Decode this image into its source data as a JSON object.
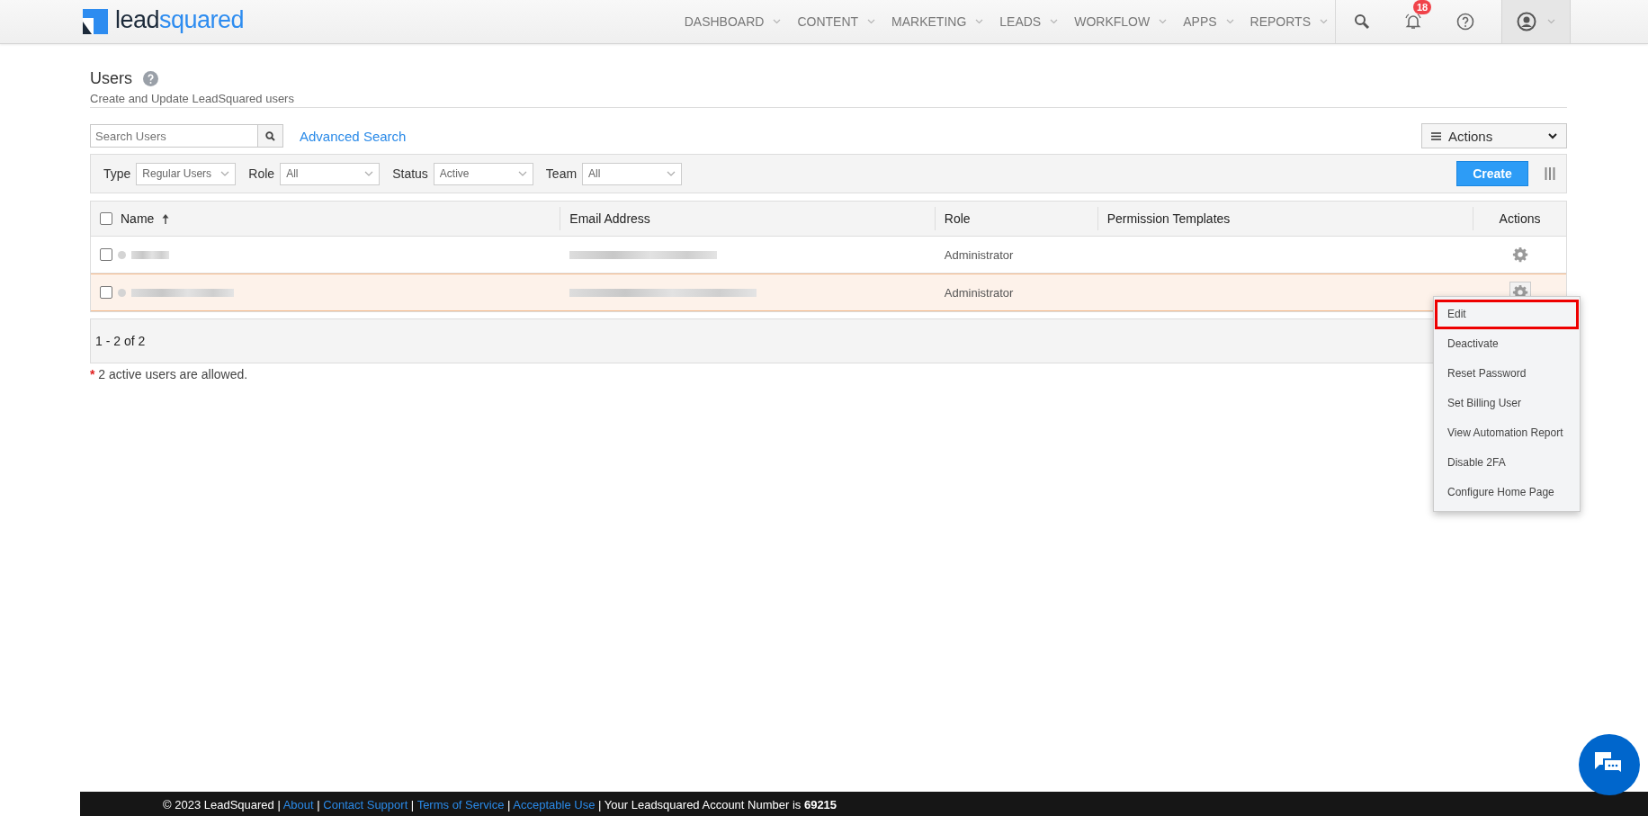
{
  "header": {
    "logo": {
      "dark": "lead",
      "accent": "squared"
    },
    "nav": [
      {
        "label": "DASHBOARD"
      },
      {
        "label": "CONTENT"
      },
      {
        "label": "MARKETING"
      },
      {
        "label": "LEADS"
      },
      {
        "label": "WORKFLOW"
      },
      {
        "label": "APPS"
      },
      {
        "label": "REPORTS"
      }
    ],
    "notification_count": "18"
  },
  "page": {
    "title": "Users",
    "subtitle": "Create and Update LeadSquared users"
  },
  "search": {
    "placeholder": "Search Users",
    "advanced_link": "Advanced Search"
  },
  "actions_menu": {
    "label": "Actions"
  },
  "filters": [
    {
      "label": "Type",
      "value": "Regular Users"
    },
    {
      "label": "Role",
      "value": "All"
    },
    {
      "label": "Status",
      "value": "Active"
    },
    {
      "label": "Team",
      "value": "All"
    }
  ],
  "create_button": "Create",
  "table": {
    "select_all_checked": false,
    "columns": [
      "Name",
      "Email Address",
      "Role",
      "Permission Templates",
      "Actions"
    ],
    "rows": [
      {
        "checked": false,
        "highlighted": false,
        "role": "Administrator"
      },
      {
        "checked": false,
        "highlighted": true,
        "role": "Administrator"
      }
    ],
    "pager": "1 - 2 of 2"
  },
  "note": {
    "mark": "*",
    "count": "2",
    "text": "active users are allowed."
  },
  "row_menu": [
    {
      "label": "Edit",
      "selected": true
    },
    {
      "label": "Deactivate",
      "selected": false
    },
    {
      "label": "Reset Password",
      "selected": false
    },
    {
      "label": "Set Billing User",
      "selected": false
    },
    {
      "label": "View Automation Report",
      "selected": false
    },
    {
      "label": "Disable 2FA",
      "selected": false
    },
    {
      "label": "Configure Home Page",
      "selected": false
    }
  ],
  "footer": {
    "copyright": "© 2023 LeadSquared",
    "separator": "|",
    "links": [
      "About",
      "Contact Support",
      "Terms of Service",
      "Acceptable Use"
    ],
    "account": "Your Leadsquared Account Number is **69215**"
  }
}
